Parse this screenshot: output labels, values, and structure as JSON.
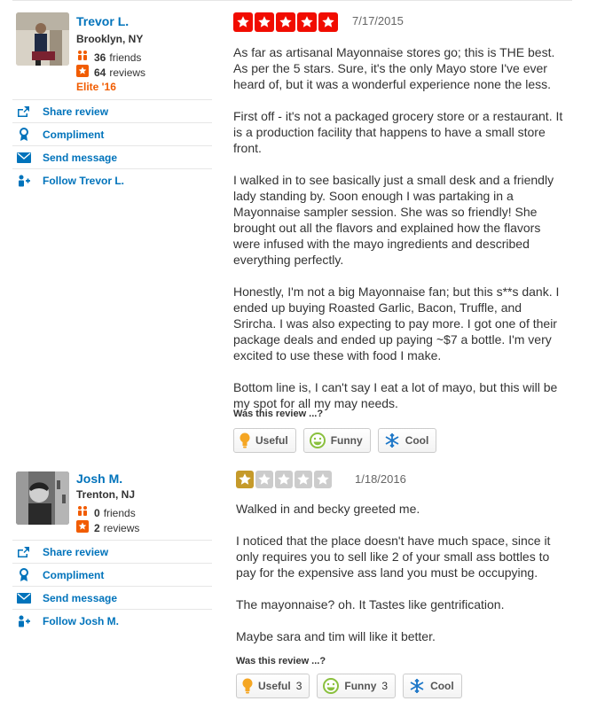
{
  "reviews": [
    {
      "user": {
        "name": "Trevor L.",
        "location": "Brooklyn, NY",
        "friends": "36",
        "friends_label": "friends",
        "reviews": "64",
        "reviews_label": "reviews",
        "elite": "Elite '16"
      },
      "actions": [
        "Share review",
        "Compliment",
        "Send message",
        "Follow Trevor L."
      ],
      "rating": 5,
      "date": "7/17/2015",
      "paragraphs": [
        "As far as artisanal Mayonnaise stores go; this is THE best. As per the 5 stars. Sure, it's the only Mayo store I've ever heard of, but it was a wonderful experience none the less.",
        "First off - it's not a packaged grocery store or a restaurant.  It is a  production facility that happens to have a small store front.",
        "I walked in to see basically just a small desk and a friendly lady standing by. Soon enough I was partaking in a Mayonnaise sampler session. She was so friendly! She brought out all the flavors and explained how the flavors were infused with the mayo ingredients and described everything perfectly.",
        "Honestly, I'm not a big Mayonnaise fan; but this s**s dank. I ended up buying Roasted Garlic, Bacon, Truffle, and Srircha. I was also expecting to pay more. I got one of their package deals and ended up paying ~$7 a bottle.  I'm very excited to use these with food I make.",
        "Bottom line is, I can't say I eat a lot of mayo, but this will be my spot for all my may needs."
      ],
      "was_this": "Was this review ...?",
      "votes": [
        {
          "label": "Useful",
          "count": ""
        },
        {
          "label": "Funny",
          "count": ""
        },
        {
          "label": "Cool",
          "count": ""
        }
      ]
    },
    {
      "user": {
        "name": "Josh M.",
        "location": "Trenton, NJ",
        "friends": "0",
        "friends_label": "friends",
        "reviews": "2",
        "reviews_label": "reviews"
      },
      "actions": [
        "Share review",
        "Compliment",
        "Send message",
        "Follow Josh M."
      ],
      "rating": 1,
      "date": "1/18/2016",
      "paragraphs": [
        "Walked in and becky greeted me.",
        "I noticed that the place doesn't have much space, since it only requires you to sell like 2 of your small ass bottles to pay for the expensive ass land you must be occupying.",
        "The mayonnaise? oh. It Tastes like gentrification.",
        "Maybe sara and tim will like it better."
      ],
      "was_this": "Was this review ...?",
      "votes": [
        {
          "label": "Useful",
          "count": "3"
        },
        {
          "label": "Funny",
          "count": "3"
        },
        {
          "label": "Cool",
          "count": ""
        }
      ]
    }
  ],
  "colors": {
    "link": "#0073bb",
    "star5": "#f10c00",
    "star1": "#c59a2a",
    "star_empty": "#cccccc",
    "elite": "#f15c00"
  },
  "icons": [
    "share-icon",
    "compliment-icon",
    "message-icon",
    "follow-icon",
    "friends-icon",
    "reviews-icon",
    "useful-icon",
    "funny-icon",
    "cool-icon",
    "star-icon"
  ]
}
